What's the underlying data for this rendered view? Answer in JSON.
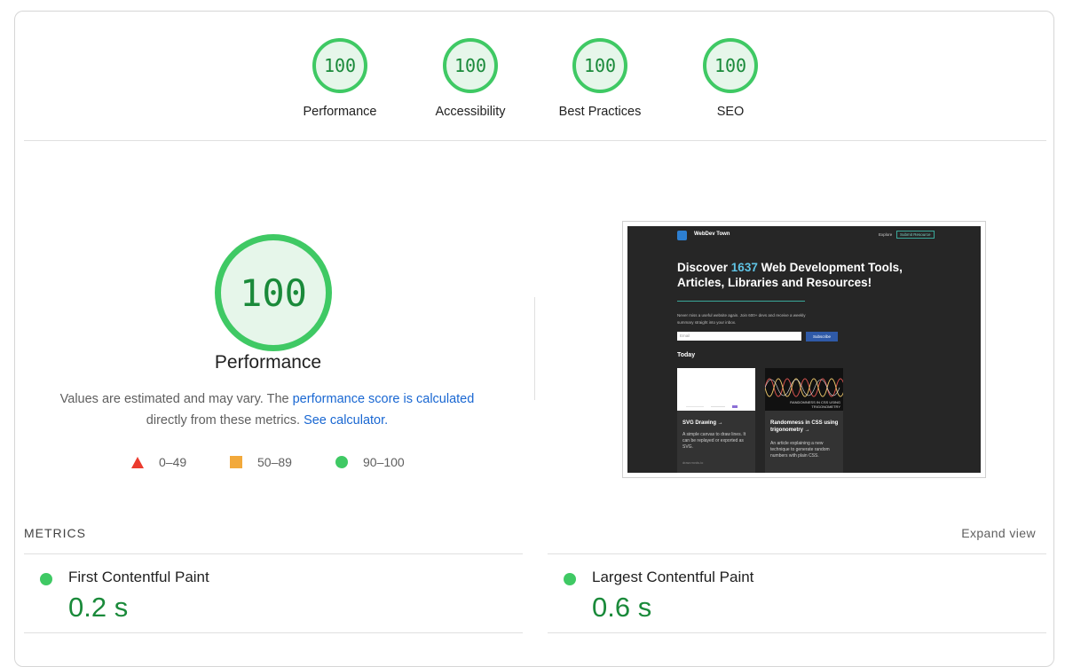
{
  "summary_gauges": [
    {
      "score": "100",
      "label": "Performance"
    },
    {
      "score": "100",
      "label": "Accessibility"
    },
    {
      "score": "100",
      "label": "Best Practices"
    },
    {
      "score": "100",
      "label": "SEO"
    }
  ],
  "performance": {
    "score": "100",
    "title": "Performance",
    "desc_prefix": "Values are estimated and may vary. The ",
    "desc_link": "performance score is calculated",
    "desc_middle": " directly from these metrics. ",
    "desc_calc_link": "See calculator.",
    "legend": [
      {
        "shape": "triangle",
        "range": "0–49",
        "color": "#eb3b2e"
      },
      {
        "shape": "square",
        "range": "50–89",
        "color": "#f2a93b"
      },
      {
        "shape": "circle",
        "range": "90–100",
        "color": "#3fc964"
      }
    ]
  },
  "screenshot": {
    "brand": "WebDev Town",
    "nav_explore": "Explore",
    "nav_submit": "Submit Resource",
    "headline_pre": "Discover ",
    "headline_count": "1637",
    "headline_post": " Web Development Tools, Articles, Libraries and Resources!",
    "lead": "Never miss a useful website again. Join 600+ devs and receive a weekly summary straight into your inbox.",
    "email_placeholder": "Email",
    "subscribe": "Subscribe",
    "section": "Today",
    "cards": [
      {
        "title": "SVG Drawing →",
        "desc": "A simple canvas to draw lines. It can be replayed or exported as SVG.",
        "meta": "draw.mvds.io"
      },
      {
        "title": "Randomness in CSS using trigonometry →",
        "desc": "An article explaining a new technique to generate random numbers with plain CSS.",
        "thumb_caption": "RANDOMNESS IN CSS USING TRIGONOMETRY"
      }
    ]
  },
  "metrics": {
    "heading": "METRICS",
    "expand": "Expand view",
    "items": [
      {
        "name": "First Contentful Paint",
        "value": "0.2 s"
      },
      {
        "name": "Largest Contentful Paint",
        "value": "0.6 s"
      }
    ]
  },
  "colors": {
    "good": "#3fc964",
    "good_text": "#1a8a3a",
    "link": "#1967d2"
  }
}
